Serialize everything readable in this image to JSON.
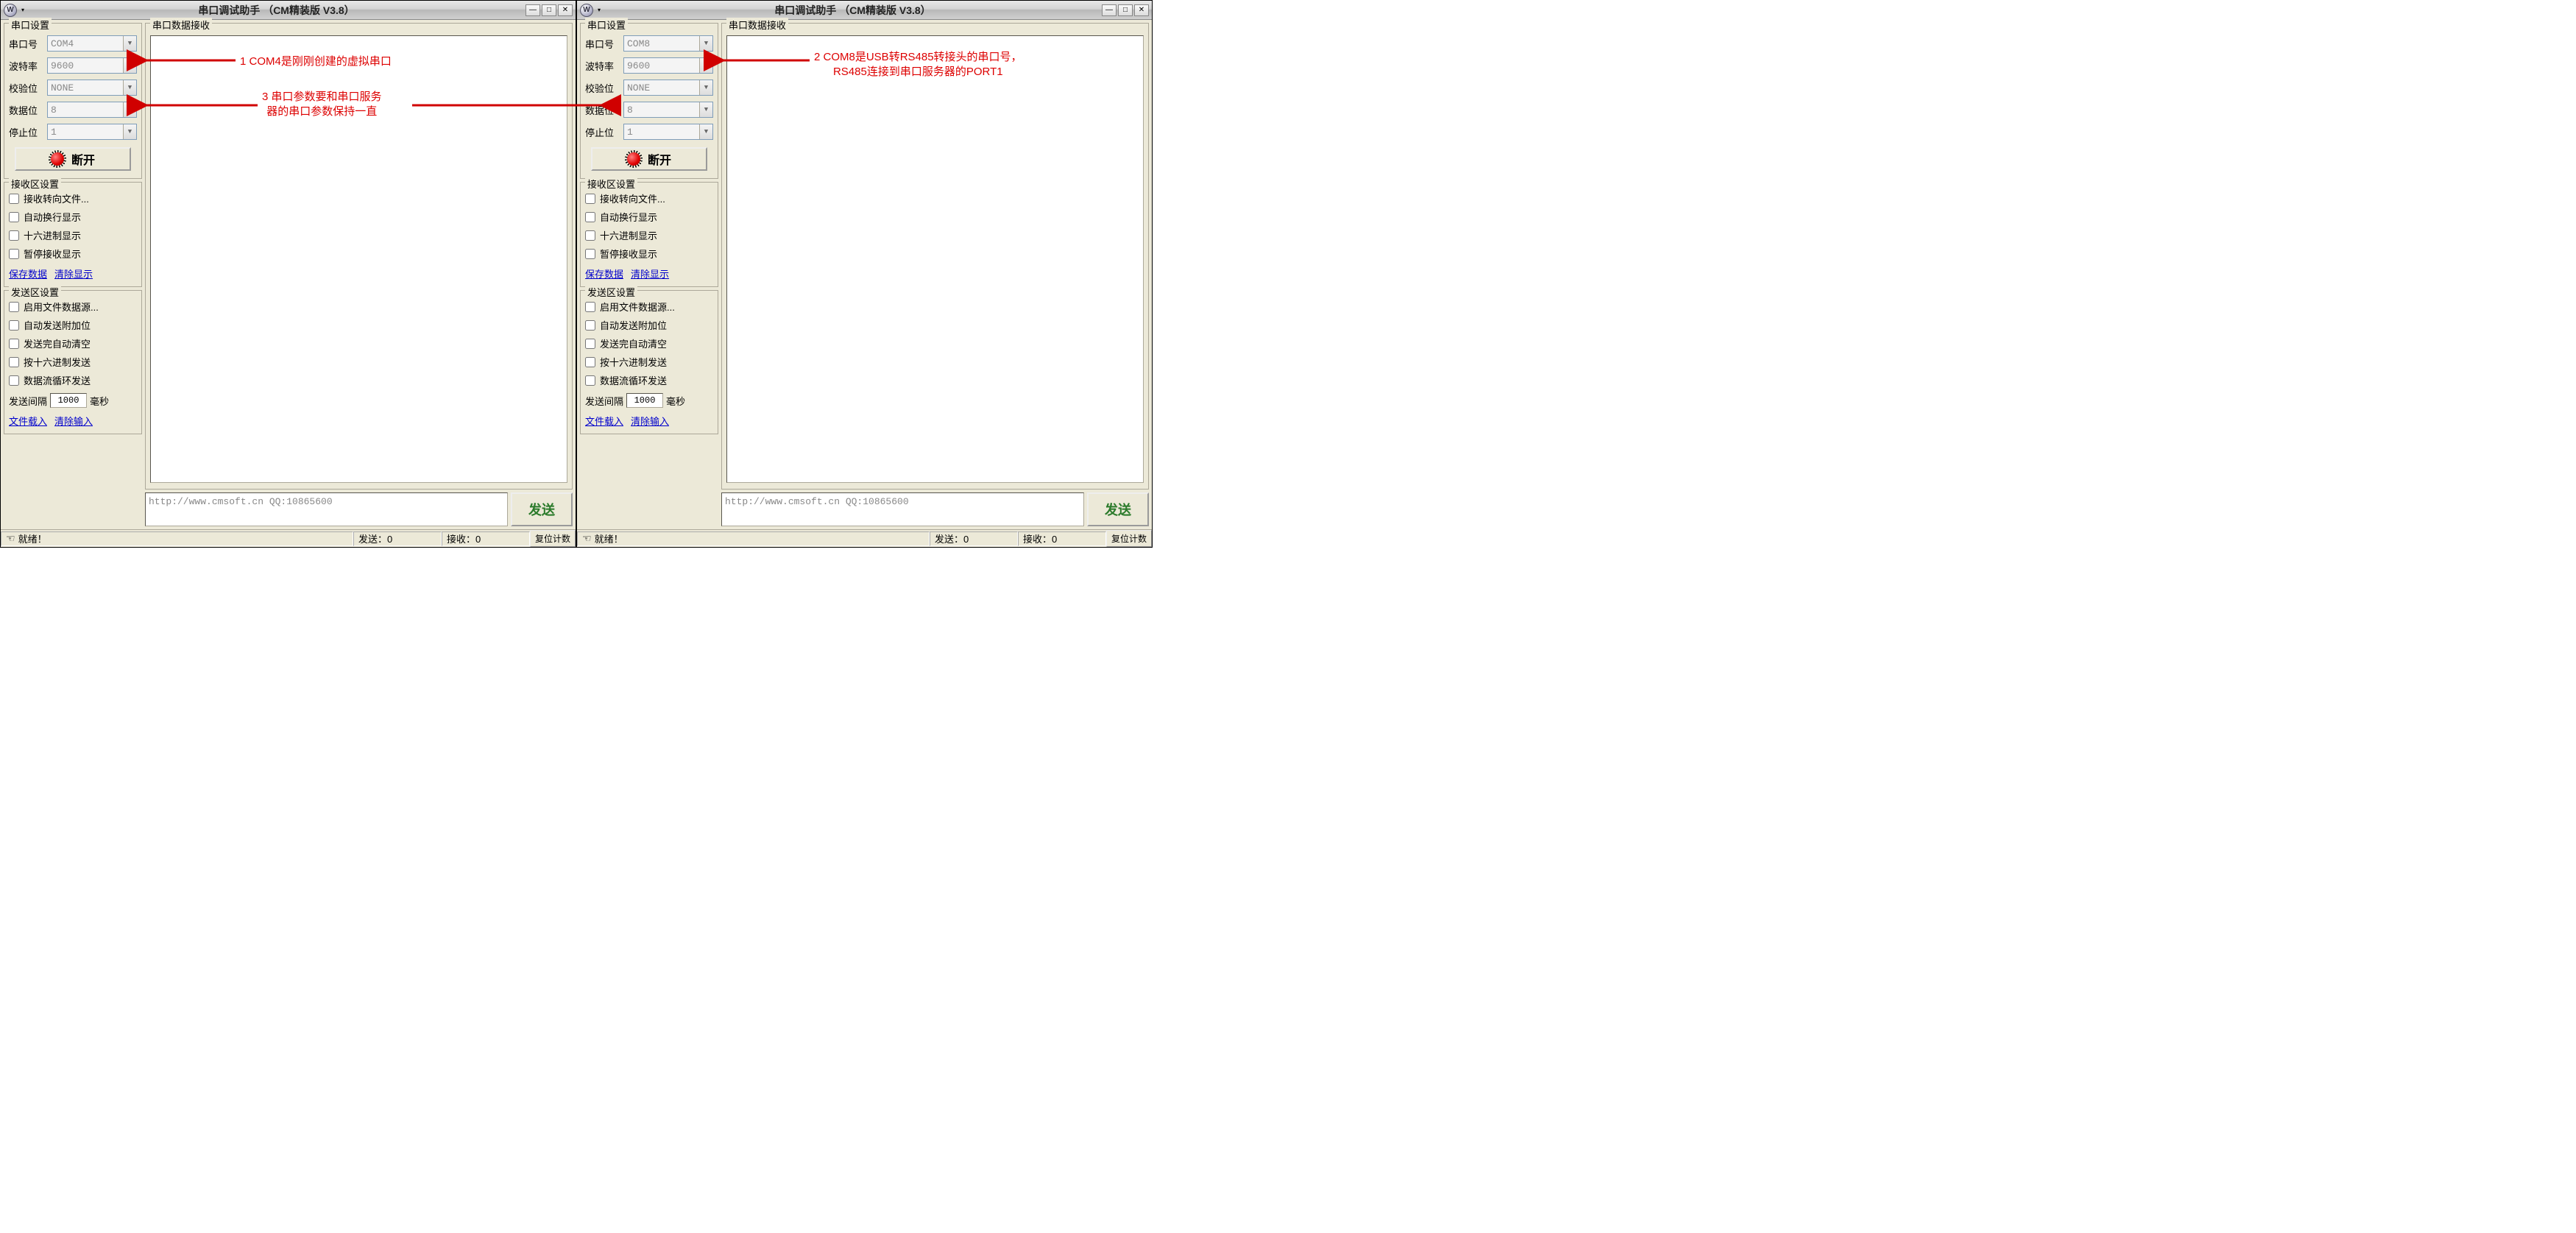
{
  "left": {
    "title": "串口调试助手 （CM精装版 V3.8）",
    "serial": {
      "legend": "串口设置",
      "port_label": "串口号",
      "port_value": "COM4",
      "baud_label": "波特率",
      "baud_value": "9600",
      "parity_label": "校验位",
      "parity_value": "NONE",
      "data_label": "数据位",
      "data_value": "8",
      "stop_label": "停止位",
      "stop_value": "1",
      "disconnect": "断开"
    },
    "recv": {
      "legend": "接收区设置",
      "to_file": "接收转向文件...",
      "auto_wrap": "自动换行显示",
      "hex": "十六进制显示",
      "pause": "暂停接收显示",
      "save": "保存数据",
      "clear": "清除显示"
    },
    "send": {
      "legend": "发送区设置",
      "file_src": "启用文件数据源...",
      "auto_append": "自动发送附加位",
      "auto_clear": "发送完自动清空",
      "hex_send": "按十六进制发送",
      "loop_send": "数据流循环发送",
      "interval_label": "发送间隔",
      "interval_value": "1000",
      "interval_unit": "毫秒",
      "file_load": "文件载入",
      "clear_input": "清除输入"
    },
    "recv_panel": {
      "legend": "串口数据接收"
    },
    "send_input": "http://www.cmsoft.cn QQ:10865600",
    "send_btn": "发送",
    "status": {
      "ready": "就绪！",
      "sent": "发送：0",
      "recv": "接收：0",
      "reset": "复位计数"
    }
  },
  "right": {
    "title": "串口调试助手 （CM精装版 V3.8）",
    "serial": {
      "legend": "串口设置",
      "port_label": "串口号",
      "port_value": "COM8",
      "baud_label": "波特率",
      "baud_value": "9600",
      "parity_label": "校验位",
      "parity_value": "NONE",
      "data_label": "数据位",
      "data_value": "8",
      "stop_label": "停止位",
      "stop_value": "1",
      "disconnect": "断开"
    },
    "recv": {
      "legend": "接收区设置",
      "to_file": "接收转向文件...",
      "auto_wrap": "自动换行显示",
      "hex": "十六进制显示",
      "pause": "暂停接收显示",
      "save": "保存数据",
      "clear": "清除显示"
    },
    "send": {
      "legend": "发送区设置",
      "file_src": "启用文件数据源...",
      "auto_append": "自动发送附加位",
      "auto_clear": "发送完自动清空",
      "hex_send": "按十六进制发送",
      "loop_send": "数据流循环发送",
      "interval_label": "发送间隔",
      "interval_value": "1000",
      "interval_unit": "毫秒",
      "file_load": "文件载入",
      "clear_input": "清除输入"
    },
    "recv_panel": {
      "legend": "串口数据接收"
    },
    "send_input": "http://www.cmsoft.cn QQ:10865600",
    "send_btn": "发送",
    "status": {
      "ready": "就绪！",
      "sent": "发送：0",
      "recv": "接收：0",
      "reset": "复位计数"
    }
  },
  "annot": {
    "a1": "1 COM4是刚刚创建的虚拟串口",
    "a2_l1": "2 COM8是USB转RS485转接头的串口号，",
    "a2_l2": "RS485连接到串口服务器的PORT1",
    "a3_l1": "3 串口参数要和串口服务",
    "a3_l2": "器的串口参数保持一直"
  },
  "colors": {
    "annot": "#d00000"
  }
}
